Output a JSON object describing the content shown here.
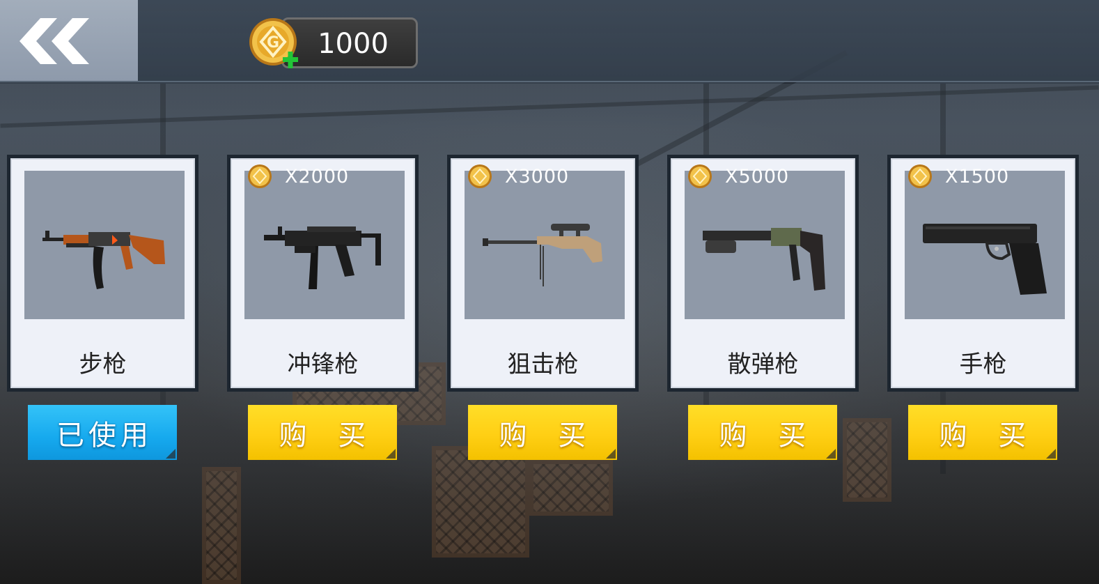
{
  "header": {
    "coins": "1000"
  },
  "weapons": [
    {
      "name": "步枪",
      "price": "",
      "action": "已使用",
      "state": "equipped",
      "icon": "ak47-rifle-icon"
    },
    {
      "name": "冲锋枪",
      "price": "X2000",
      "action": "购 买",
      "state": "buy",
      "icon": "mp5-smg-icon"
    },
    {
      "name": "狙击枪",
      "price": "X3000",
      "action": "购 买",
      "state": "buy",
      "icon": "sniper-rifle-icon"
    },
    {
      "name": "散弹枪",
      "price": "X5000",
      "action": "购 买",
      "state": "buy",
      "icon": "shotgun-icon"
    },
    {
      "name": "手枪",
      "price": "X1500",
      "action": "购 买",
      "state": "buy",
      "icon": "pistol-icon"
    }
  ],
  "colors": {
    "buy_button": "#ffcf14",
    "used_button": "#16a9ee",
    "card_image_bg": "#8f99a8",
    "coin_gold": "#e7a92a"
  }
}
